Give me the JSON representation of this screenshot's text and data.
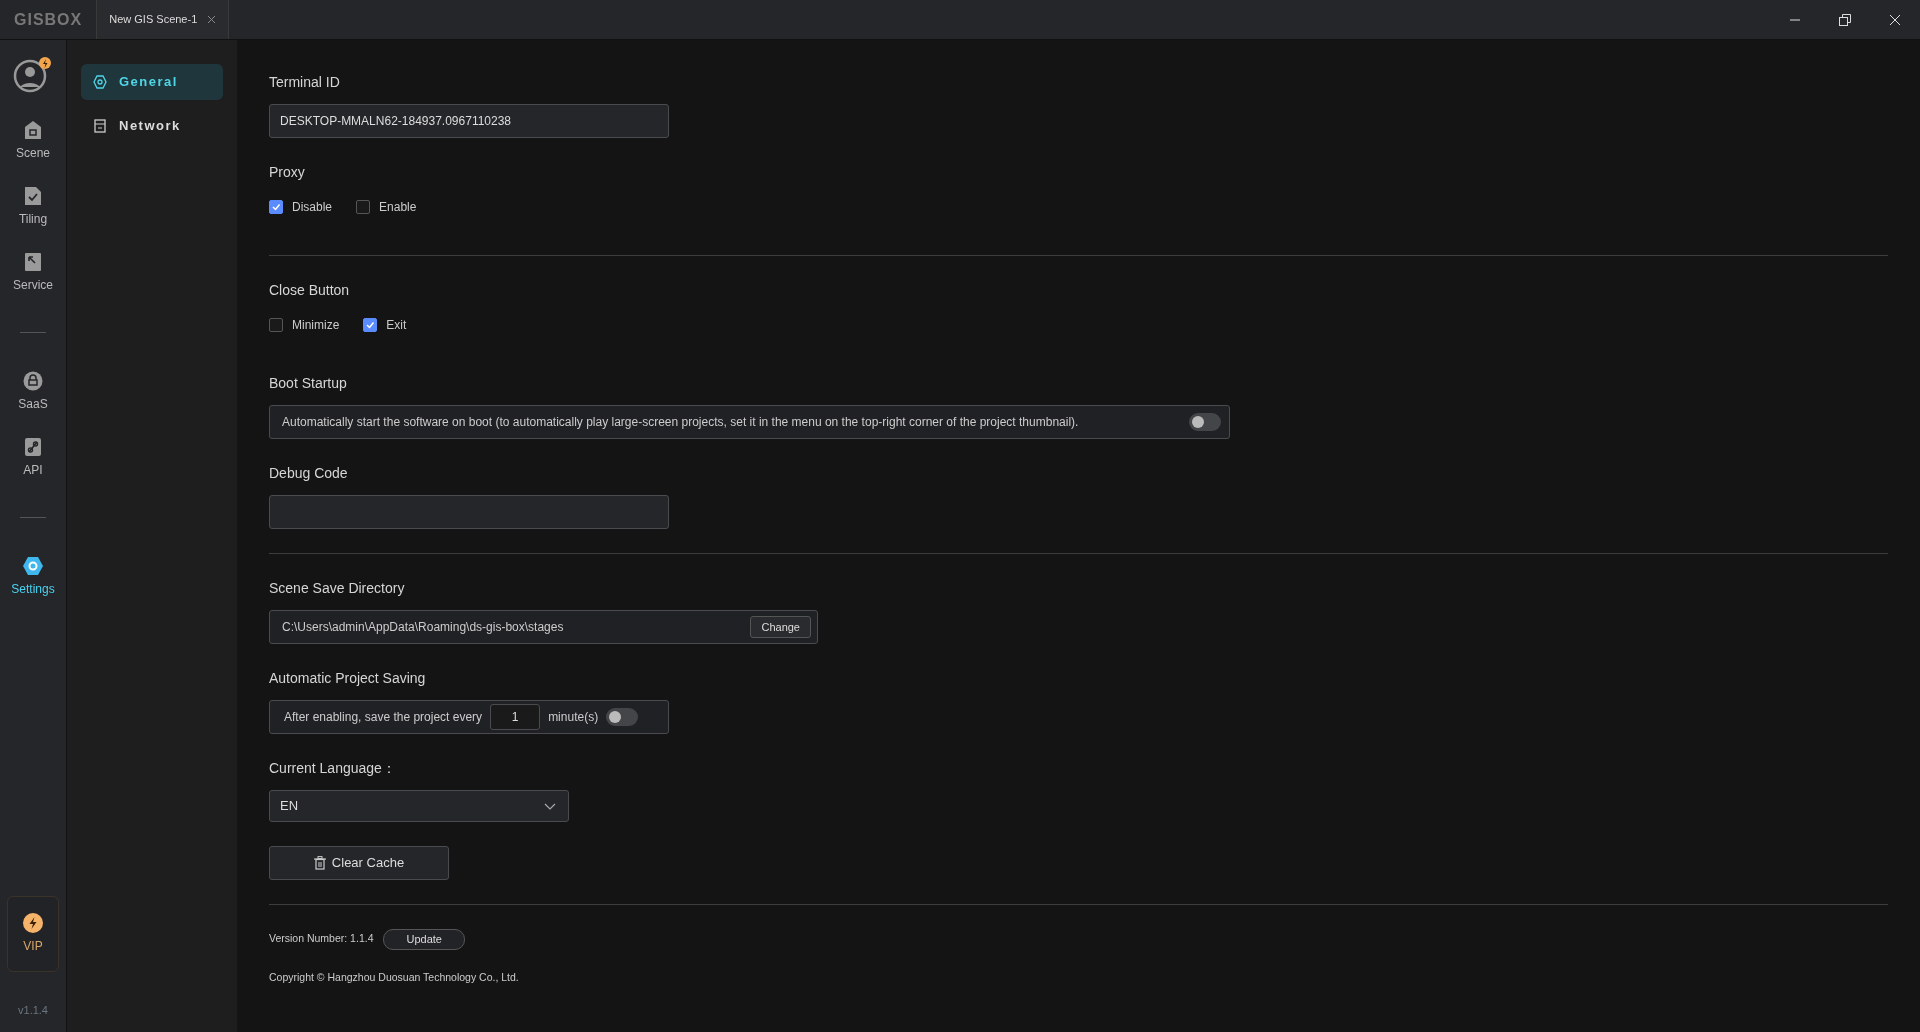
{
  "title_bar": {
    "logo": "GISBOX",
    "tabs": [
      {
        "label": "New GIS Scene-1"
      }
    ]
  },
  "rail": {
    "items": [
      {
        "kind": "nav",
        "label": "Scene",
        "selected": false
      },
      {
        "kind": "nav",
        "label": "Tiling",
        "selected": false
      },
      {
        "kind": "nav",
        "label": "Service",
        "selected": false
      },
      {
        "kind": "divider"
      },
      {
        "kind": "nav",
        "label": "SaaS",
        "selected": false
      },
      {
        "kind": "nav",
        "label": "API",
        "selected": false
      },
      {
        "kind": "divider"
      },
      {
        "kind": "nav",
        "label": "Settings",
        "selected": true
      }
    ],
    "vip": {
      "label": "VIP"
    },
    "version": "v1.1.4"
  },
  "settings_menu": [
    {
      "label": "General",
      "selected": true
    },
    {
      "label": "Network",
      "selected": false
    }
  ],
  "sections": [
    {
      "kind": "text_field",
      "label": "Terminal ID",
      "value": "DESKTOP-MMALN62-184937.0967110238"
    },
    {
      "kind": "checkboxes",
      "label": "Proxy",
      "options": [
        {
          "label": "Disable",
          "checked": true
        },
        {
          "label": "Enable",
          "checked": false
        }
      ]
    },
    {
      "kind": "divider"
    },
    {
      "kind": "checkboxes",
      "label": "Close Button",
      "options": [
        {
          "label": "Minimize",
          "checked": false
        },
        {
          "label": "Exit",
          "checked": true
        }
      ]
    },
    {
      "kind": "toggle",
      "label": "Boot Startup",
      "text": "Automatically start the software on boot (to automatically play large-screen projects, set it in the menu on the top-right corner of the project thumbnail).",
      "on": false
    },
    {
      "kind": "text_field",
      "label": "Debug Code"
    },
    {
      "kind": "divider"
    },
    {
      "kind": "path",
      "label": "Scene Save Directory",
      "value": "C:\\Users\\admin\\AppData\\Roaming\\ds-gis-box\\stages",
      "button": "Change"
    },
    {
      "kind": "interval",
      "label": "Automatic Project Saving",
      "before": "After enabling, save the project every",
      "value": "1",
      "after": "minute(s)",
      "on": false
    },
    {
      "kind": "select",
      "label": "Current Language：",
      "value": "EN"
    },
    {
      "kind": "button",
      "label": "Clear Cache"
    },
    {
      "kind": "divider"
    }
  ],
  "footer": {
    "version": "Version Number: 1.1.4",
    "update": "Update",
    "copyright": "Copyright © Hangzhou Duosuan Technology Co., Ltd."
  }
}
